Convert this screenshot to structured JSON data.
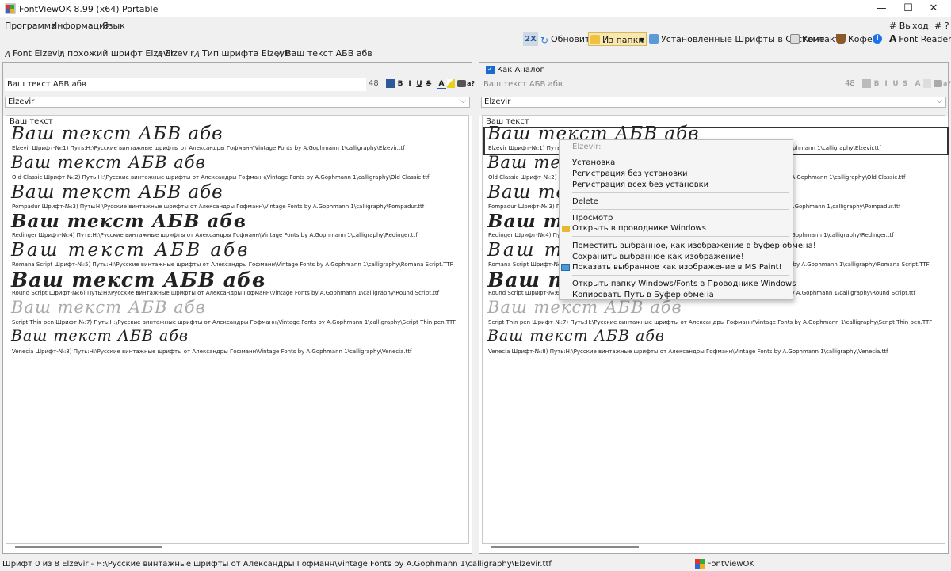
{
  "window": {
    "title": "FontViewOK 8.99  (x64) Portable",
    "minimize": "—",
    "maximize": "☐",
    "close": "✕"
  },
  "menu": {
    "items": [
      "Программа",
      "Информация",
      "Язык"
    ],
    "exit": "# Выход",
    "help": "# ?"
  },
  "toolbar": {
    "zoom_2x": "2X",
    "refresh": "Обновить",
    "from_folder": "Из папки",
    "installed_fonts": "Установленные Шрифты в Системе",
    "contact": "Контакт",
    "coffee": "Кофе",
    "info": "i",
    "font_reader": "Font Reader"
  },
  "crumbs": [
    "Font Elzevir",
    "похожий шрифт  Elzevir",
    "Elzevir",
    "Тип шрифта  Elzevir",
    "Ваш текст АБВ абв"
  ],
  "left_panel": {
    "text_input": "Ваш текст АБВ абв",
    "size": "48",
    "format_buttons": [
      "B",
      "I",
      "U",
      "S",
      "A",
      "a?"
    ],
    "font_select": "Elzevir",
    "sample_label": "Ваш текст"
  },
  "right_panel": {
    "as_analog_label": "Как Аналог",
    "as_analog_checked": true,
    "text_input": "Ваш текст АБВ абв",
    "size": "48",
    "font_select": "Elzevir",
    "sample_label": "Ваш текст"
  },
  "font_entries": [
    {
      "sample": "Ваш текст АБВ абв",
      "path": "Elzevir Шрифт-№:1) Путь:H:\\Русские винтажные шрифты от  Александры Гофманн\\Vintage Fonts by A.Gophmann 1\\calligraphy\\Elzevir.ttf"
    },
    {
      "sample": "Ваш текст АБВ абв",
      "path": "Old Classic Шрифт-№:2) Путь:H:\\Русские винтажные шрифты от  Александры Гофманн\\Vintage Fonts by A.Gophmann 1\\calligraphy\\Old Classic.ttf"
    },
    {
      "sample": "Ваш текст АБВ абв",
      "path": "Pompadur Шрифт-№:3) Путь:H:\\Русские винтажные шрифты от  Александры Гофманн\\Vintage Fonts by A.Gophmann 1\\calligraphy\\Pompadur.ttf"
    },
    {
      "sample": "Ваш текст АБВ абв",
      "path": "Redinger Шрифт-№:4) Путь:H:\\Русские винтажные шрифты от  Александры Гофманн\\Vintage Fonts by A.Gophmann 1\\calligraphy\\Redinger.ttf"
    },
    {
      "sample": "Ваш текст АБВ абв",
      "path": "Romana Script Шрифт-№:5) Путь:H:\\Русские винтажные шрифты от  Александры Гофманн\\Vintage Fonts by A.Gophmann 1\\calligraphy\\Romana Script.TTF"
    },
    {
      "sample": "Ваш текст АБВ абв",
      "path": "Round Script Шрифт-№:6) Путь:H:\\Русские винтажные шрифты от  Александры Гофманн\\Vintage Fonts by A.Gophmann 1\\calligraphy\\Round Script.ttf"
    },
    {
      "sample": "Ваш текст АБВ абв",
      "path": "Script Thin pen Шрифт-№:7) Путь:H:\\Русские винтажные шрифты от  Александры Гофманн\\Vintage Fonts by A.Gophmann 1\\calligraphy\\Script Thin pen.TTF"
    },
    {
      "sample": "Ваш текст АБВ абв",
      "path": "Venecia Шрифт-№:8) Путь:H:\\Русские винтажные шрифты от  Александры Гофманн\\Vintage Fonts by A.Gophmann 1\\calligraphy\\Venecia.ttf"
    }
  ],
  "context_menu": {
    "header": "Elzevir:",
    "install": "Установка",
    "register": "Регистрация без установки",
    "register_all": "Регистрация всех без установки",
    "delete": "Delete",
    "view": "Просмотр",
    "open_explorer": "Открыть в проводнике Windows",
    "copy_image": "Поместить выбранное, как изображение в буфер обмена!",
    "save_image": "Сохранить выбранное как изображение!",
    "show_paint": "Показать выбранное как изображение в MS Paint!",
    "open_fonts_folder": "Открыть папку Windows/Fonts в Проводнике Windows",
    "copy_path": "Копировать Путь в Буфер обмена"
  },
  "status": {
    "text": "Шрифт 0 из 8 Elzevir - H:\\Русские винтажные шрифты от  Александры Гофманн\\Vintage Fonts by A.Gophmann 1\\calligraphy\\Elzevir.ttf",
    "app": "FontViewOK"
  }
}
